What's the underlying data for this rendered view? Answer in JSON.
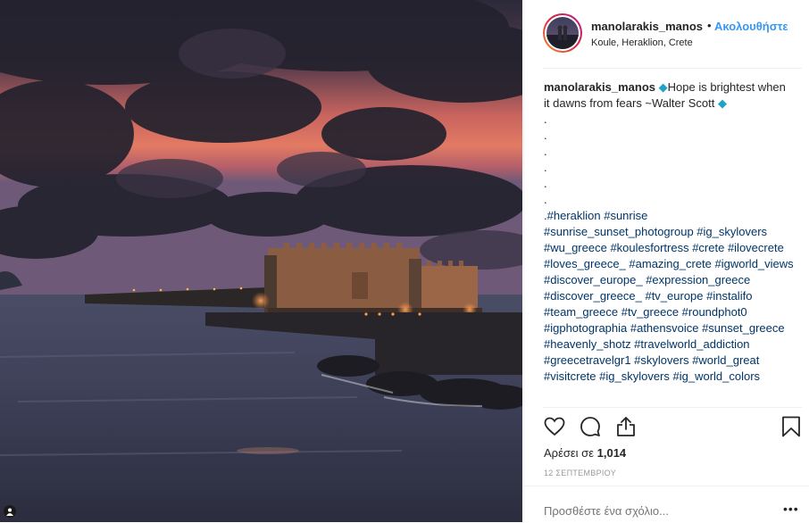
{
  "photo": {
    "alt_icon": "user-tag-icon"
  },
  "header": {
    "username": "manolarakis_manos",
    "separator": "•",
    "follow_label": "Ακολουθήστε",
    "location": "Koule, Heraklion, Crete"
  },
  "caption": {
    "username": "manolarakis_manos",
    "diamond": "◆",
    "text_1": "Hope is brightest when it dawns from fears ~Walter Scott",
    "dots": [
      ".",
      ".",
      ".",
      ".",
      ".",
      "."
    ],
    "hashtags": ".#heraklion #sunrise #sunrise_sunset_photogroup #ig_skylovers #wu_greece #koulesfortress #crete #ilovecrete #loves_greece_ #amazing_crete #igworld_views #discover_europe_ #expression_greece #discover_greece_ #tv_europe #instalifo #team_greece #tv_greece #roundphot0 #igphotographia #athensvoice #sunset_greece #heavenly_shotz #travelworld_addiction #greecetravelgr1 #skylovers #world_great #visitcrete #ig_skylovers #ig_world_colors"
  },
  "actions": {
    "like_icon": "heart-icon",
    "comment_icon": "comment-icon",
    "share_icon": "share-icon",
    "save_icon": "bookmark-icon"
  },
  "likes": {
    "prefix": "Αρέσει σε",
    "count": "1,014"
  },
  "date": "12 ΣΕΠΤΕΜΒΡΙΟΥ",
  "comment": {
    "placeholder": "Προσθέστε ένα σχόλιο...",
    "more_label": "•••"
  },
  "colors": {
    "link": "#3897f0",
    "hashtag": "#003569",
    "diamond": "#1fa2c6",
    "text": "#262626",
    "muted": "#999999"
  }
}
